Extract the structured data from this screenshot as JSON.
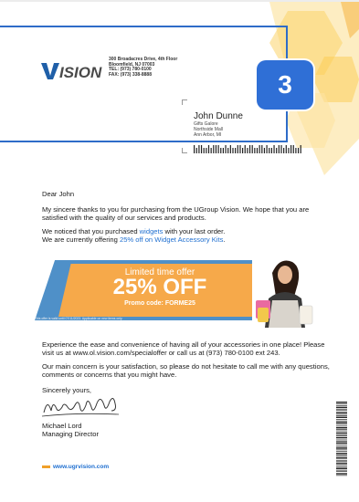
{
  "badge": "3",
  "logo": {
    "text": "VISION"
  },
  "sender": {
    "address1": "300 Broadacres Drive, 4th Floor",
    "address2": "Bloomfield, NJ 07003",
    "tel": "TEL: (973) 780-0100",
    "fax": "FAX: (973) 338-8888"
  },
  "recipient": {
    "name": "John Dunne",
    "line1": "Gifts Galore",
    "line2": "Northside Mall",
    "line3": "Ann Arbor, MI"
  },
  "letter": {
    "greeting": "Dear John",
    "para1": "My sincere thanks to you for purchasing from the UGroup Vision. We hope that you are satisfied with the quality of our services and products.",
    "para2_pre": "We noticed that you purchased ",
    "para2_link": "widgets",
    "para2_post": " with your last order.",
    "para3_pre": "We are currently offering ",
    "para3_link": "25% off on Widget Accessory Kits",
    "para3_post": ".",
    "para4": "Experience the ease and convenience of having all of your accessories in one place! Please visit us at www.ol.vision.com/specialoffer or call us at (973) 780-0100 ext 243.",
    "para5": "Our main concern is your satisfaction, so please do not hesitate to call me with any questions, comments or concerns that you might have.",
    "closing": "Sincerely yours,",
    "signer_name": "Michael Lord",
    "signer_title": "Managing Director"
  },
  "offer": {
    "title": "Limited time offer",
    "big": "25% OFF",
    "code": "Promo code: FORME25",
    "fine_print": "This offer is valid until 07/11/2023. Applicable on new items only."
  },
  "footer": {
    "url": "www.ugrvision.com"
  },
  "colors": {
    "accent": "#2f6fd6",
    "offer_orange": "#f6a94a",
    "offer_blue": "#4f90c8",
    "footer_dash": "#f0a02a"
  }
}
